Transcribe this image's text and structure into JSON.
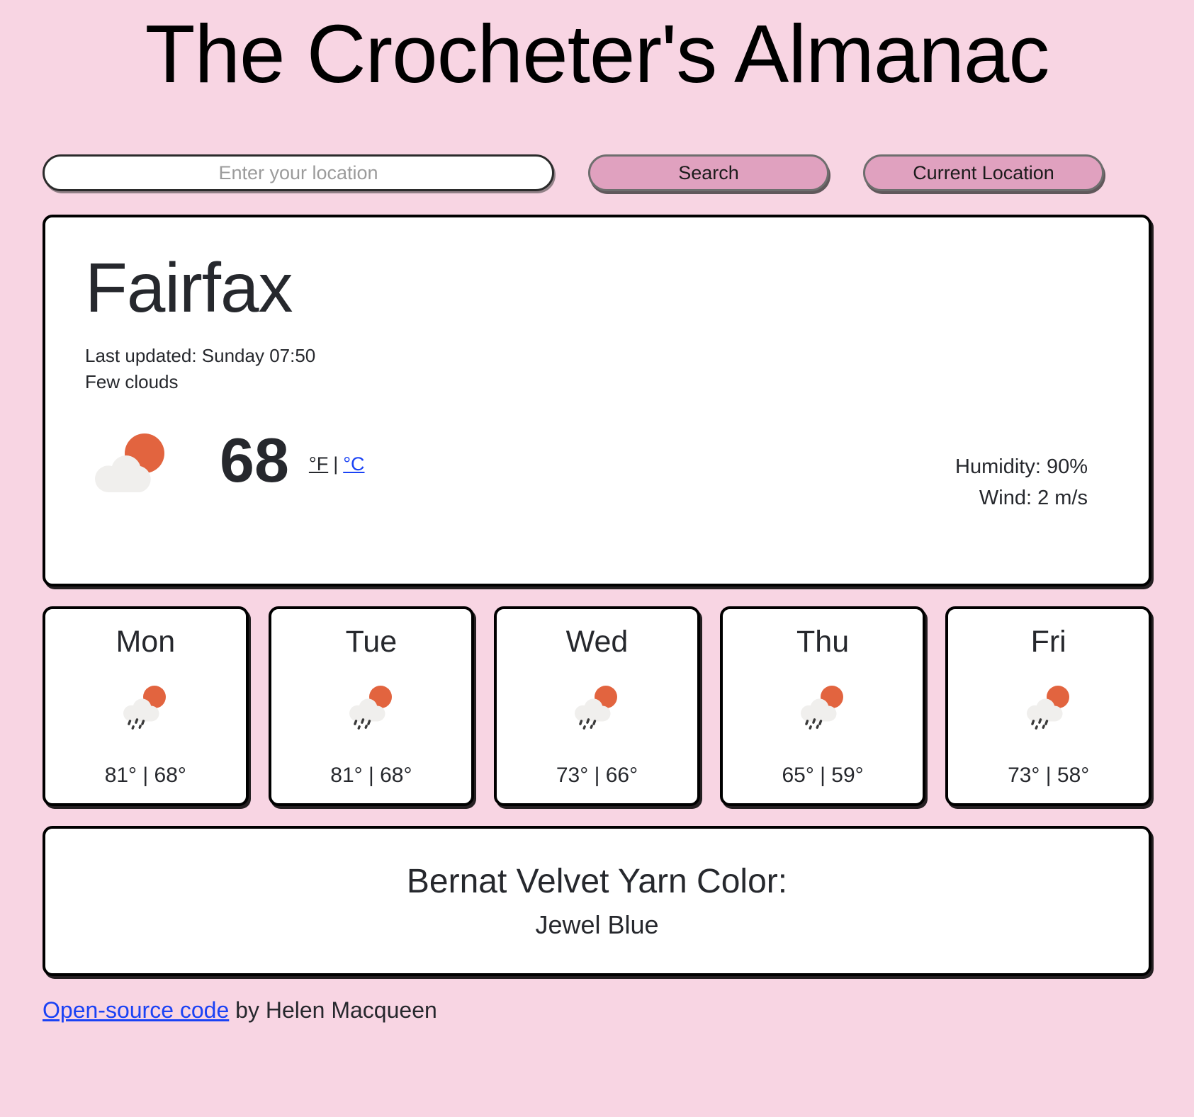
{
  "header": {
    "title": "The Crocheter's Almanac"
  },
  "search": {
    "placeholder": "Enter your location",
    "value": "",
    "search_label": "Search",
    "current_location_label": "Current Location"
  },
  "current": {
    "city": "Fairfax",
    "last_updated": "Last updated: Sunday 07:50",
    "condition": "Few clouds",
    "icon": "few-clouds-icon",
    "temperature": "68",
    "unit_f": "°F",
    "unit_separator": "|",
    "unit_c": "°C",
    "humidity": "Humidity: 90%",
    "wind": "Wind: 2 m/s"
  },
  "forecast": [
    {
      "day": "Mon",
      "icon": "sun-behind-rain-cloud-icon",
      "temps": "81° | 68°",
      "high": "81°",
      "low": "68°"
    },
    {
      "day": "Tue",
      "icon": "sun-behind-rain-cloud-icon",
      "temps": "81° | 68°",
      "high": "81°",
      "low": "68°"
    },
    {
      "day": "Wed",
      "icon": "sun-behind-rain-cloud-icon",
      "temps": "73° | 66°",
      "high": "73°",
      "low": "66°"
    },
    {
      "day": "Thu",
      "icon": "sun-behind-rain-cloud-icon",
      "temps": "65° | 59°",
      "high": "65°",
      "low": "59°"
    },
    {
      "day": "Fri",
      "icon": "sun-behind-rain-cloud-icon",
      "temps": "73° | 58°",
      "high": "73°",
      "low": "58°"
    }
  ],
  "yarn": {
    "title": "Bernat Velvet Yarn Color:",
    "color_name": "Jewel Blue"
  },
  "footer": {
    "link_text": "Open-source code",
    "rest_text": " by Helen Macqueen"
  },
  "colors": {
    "background": "#f8d5e3",
    "button_fill": "#e0a1bf",
    "link": "#1a42f5",
    "text": "#26282d",
    "sun": "#e2643f",
    "cloud": "#f0efed"
  }
}
